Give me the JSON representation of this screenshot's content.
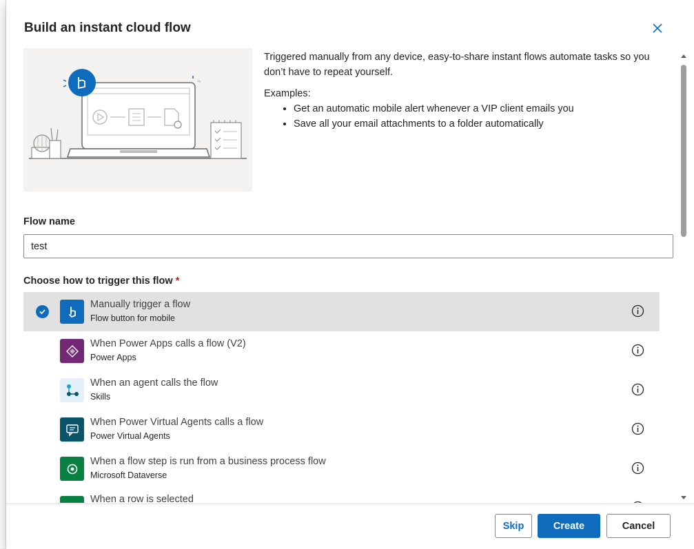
{
  "dialog": {
    "title": "Build an instant cloud flow",
    "description": "Triggered manually from any device, easy-to-share instant flows automate tasks so you don’t have to repeat yourself.",
    "examples_label": "Examples:",
    "examples": [
      "Get an automatic mobile alert whenever a VIP client emails you",
      "Save all your email attachments to a folder automatically"
    ]
  },
  "form": {
    "flow_name_label": "Flow name",
    "flow_name_value": "test",
    "trigger_label": "Choose how to trigger this flow",
    "required_marker": "*"
  },
  "triggers": [
    {
      "title": "Manually trigger a flow",
      "subtitle": "Flow button for mobile",
      "icon": "pointer-hand-icon",
      "color": "#0f6cbd",
      "selected": true
    },
    {
      "title": "When Power Apps calls a flow (V2)",
      "subtitle": "Power Apps",
      "icon": "power-apps-icon",
      "color": "#742774",
      "selected": false
    },
    {
      "title": "When an agent calls the flow",
      "subtitle": "Skills",
      "icon": "skills-icon",
      "color": "#e5f1fa",
      "selected": false
    },
    {
      "title": "When Power Virtual Agents calls a flow",
      "subtitle": "Power Virtual Agents",
      "icon": "power-virtual-agents-icon",
      "color": "#0b556a",
      "selected": false
    },
    {
      "title": "When a flow step is run from a business process flow",
      "subtitle": "Microsoft Dataverse",
      "icon": "dataverse-icon",
      "color": "#088142",
      "selected": false
    },
    {
      "title": "When a row is selected",
      "subtitle": "",
      "icon": "dataverse-icon",
      "color": "#088142",
      "selected": false
    }
  ],
  "footer": {
    "skip_label": "Skip",
    "create_label": "Create",
    "cancel_label": "Cancel"
  },
  "colors": {
    "accent": "#0f6cbd",
    "selected_row": "#e1e1e1"
  }
}
